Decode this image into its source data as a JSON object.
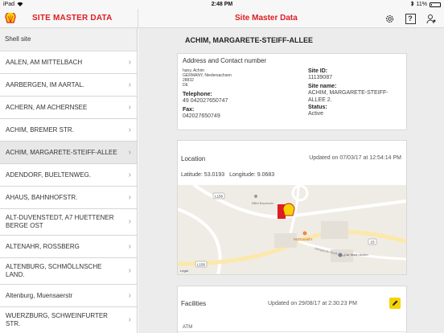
{
  "status": {
    "device": "iPad",
    "time": "2:48 PM",
    "battery": "11%"
  },
  "nav": {
    "left_title": "SITE MASTER DATA",
    "right_title": "Site Master Data"
  },
  "sidebar": {
    "header": "Shell site",
    "items": [
      {
        "label": "AALEN, AM MITTELBACH"
      },
      {
        "label": "AARBERGEN, IM AARTAL."
      },
      {
        "label": "ACHERN, AM ACHERNSEE"
      },
      {
        "label": "ACHIM, BREMER STR."
      },
      {
        "label": "ACHIM, MARGARETE-STEIFF-ALLEE"
      },
      {
        "label": "ADENDORF, BUELTENWEG."
      },
      {
        "label": "AHAUS, BAHNHOFSTR."
      },
      {
        "label": "ALT-DUVENSTEDT, A7 HUETTENER BERGE OST"
      },
      {
        "label": "ALTENAHR, ROSSBERG"
      },
      {
        "label": "ALTENBURG, SCHMÖLLNSCHE LAND."
      },
      {
        "label": "Altenburg, Muensaerstr"
      },
      {
        "label": "WUERZBURG, SCHWEINFURTER STR."
      }
    ]
  },
  "main": {
    "header": "ACHIM, MARGARETE-STEIFF-ALLEE",
    "address": {
      "title": "Address and Contact number",
      "lines": [
        "hany, Achim",
        "GERMANY, Niedersachsen",
        "28832",
        "DE"
      ],
      "telephone_label": "Telephone:",
      "telephone": "49 042027650747",
      "fax_label": "Fax:",
      "fax": "042027650749",
      "site_id_label": "Site ID:",
      "site_id": "11139087",
      "site_name_label": "Site name:",
      "site_name": "ACHIM, MARGARETE-STEIFF-ALLEE 2.",
      "status_label": "Status:",
      "status": "Active"
    },
    "location": {
      "title": "Location",
      "updated": "Updated on 07/03/17 at 12:54:14 PM",
      "latitude": "Latitude: 53.0193",
      "longitude": "Longitude: 9.0683",
      "map_labels": {
        "road1": "L156",
        "road2": "L156",
        "road3": "23",
        "poi1": "BBM Baumarkt",
        "poi2": "McDonald's",
        "poi3": "Car Wash Achim",
        "street": "Margarete-Steiff-Allee",
        "legal": "Legal"
      }
    },
    "facilities": {
      "title": "Facilities",
      "updated": "Updated on 29/08/17 at 2:30:23 PM",
      "first_item": "ATM"
    }
  },
  "colors": {
    "brand_red": "#dd1d21",
    "shell_yellow": "#f5d300"
  }
}
